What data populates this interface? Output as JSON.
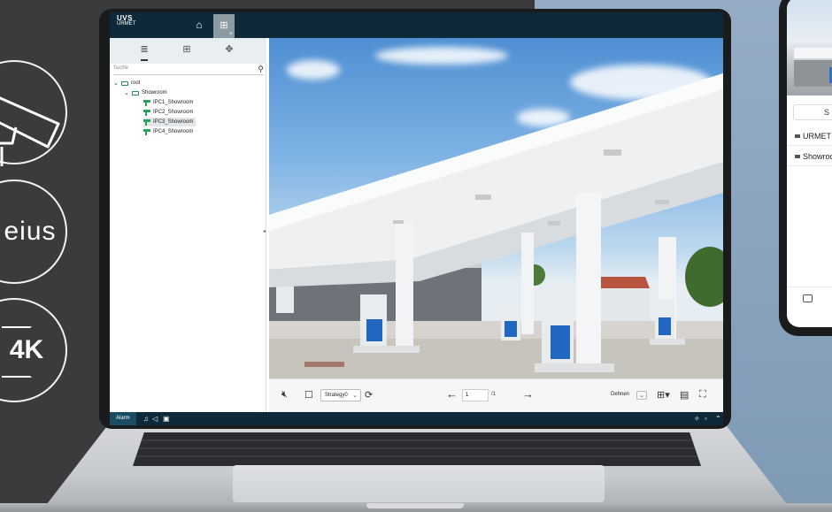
{
  "badges": {
    "second_text": "eius",
    "third_text": "4K"
  },
  "app": {
    "logo_line1": "UVS",
    "logo_line2": "URMET"
  },
  "sidebar": {
    "search_placeholder": "Suche",
    "tree": {
      "root": "root",
      "group": "Showroom",
      "cameras": [
        "IPC1_Showroom",
        "IPC2_Showroom",
        "IPC3_Showroom",
        "IPC4_Showroom"
      ],
      "selected_index": 2
    }
  },
  "toolbar": {
    "strategy": "Strategy0",
    "page_current": "1",
    "page_total": "/1",
    "stretch": "Dehnen"
  },
  "statusbar": {
    "alarm": "Alarm"
  },
  "phone": {
    "tab_label": "S",
    "row1": "URMET N",
    "row2": "Showroo"
  },
  "colors": {
    "topbar": "#0e2a3a",
    "camera_icon": "#2aa05a",
    "selected_row": "#e3e6e8"
  },
  "icons": [
    "home-icon",
    "layout-icon",
    "device-tree-icon",
    "grid-icon",
    "ptz-icon",
    "search-icon",
    "mute-icon",
    "stop-icon",
    "refresh-icon",
    "prev-arrow-icon",
    "next-arrow-icon",
    "split-grid-icon",
    "window-icon",
    "fullscreen-icon",
    "pin-icon",
    "restore-icon",
    "chevron-up-icon"
  ]
}
